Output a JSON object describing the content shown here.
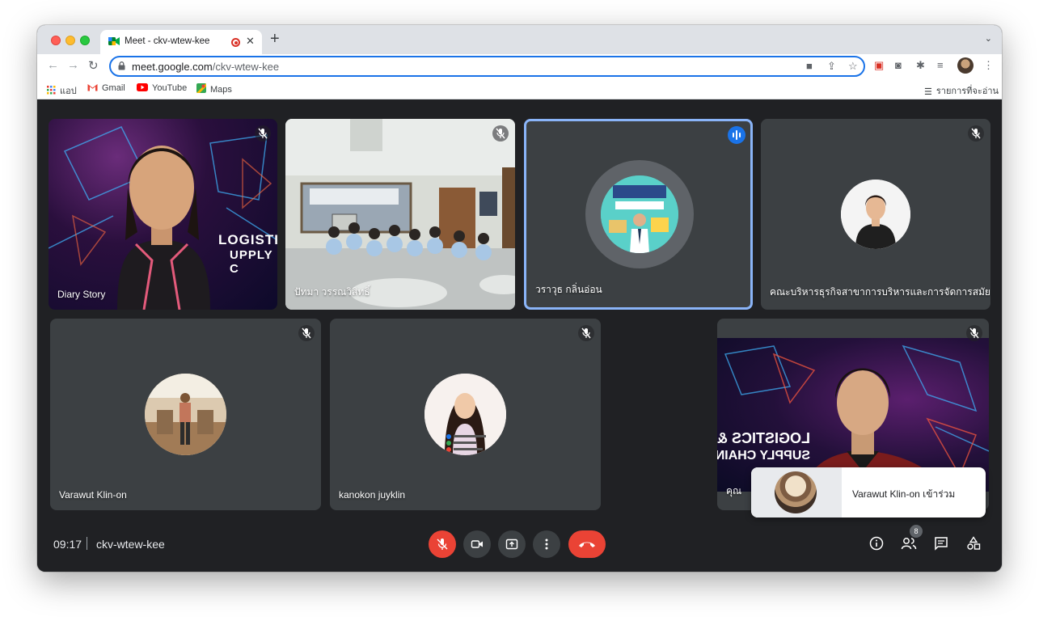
{
  "browser": {
    "tab_title": "Meet - ckv-wtew-kee",
    "new_tab_label": "+",
    "url_host": "meet.google.com",
    "url_path": "/ckv-wtew-kee",
    "bookmarks": [
      {
        "label": "แอป",
        "icon": "apps-grid-icon"
      },
      {
        "label": "Gmail",
        "icon": "gmail-icon"
      },
      {
        "label": "YouTube",
        "icon": "youtube-icon"
      },
      {
        "label": "Maps",
        "icon": "maps-icon"
      }
    ],
    "reading_list": "รายการที่จะอ่าน"
  },
  "participants": [
    {
      "name": "Diary Story",
      "muted": true,
      "video": true
    },
    {
      "name": "ปัทมา วรรณวิสิทธิ์",
      "muted": true,
      "video": true
    },
    {
      "name": "วราวุธ กลิ่นอ่อน",
      "muted": false,
      "speaking": true,
      "video": false
    },
    {
      "name": "คณะบริหารธุรกิจสาขาการบริหารและการจัดการสมัย...",
      "muted": true,
      "video": false
    },
    {
      "name": "Varawut Klin-on",
      "muted": true,
      "video": false
    },
    {
      "name": "kanokon juyklin",
      "muted": true,
      "video": false
    },
    {
      "name": "คุณ",
      "muted": true,
      "video": true
    }
  ],
  "background_text": {
    "logistics_line1": "LOGISTI",
    "logistics_line2": "UPPLY C"
  },
  "toast": {
    "text": "Varawut Klin-on เข้าร่วม"
  },
  "bottom_bar": {
    "time": "09:17",
    "meeting_code": "ckv-wtew-kee",
    "people_count": "8"
  },
  "colors": {
    "meet_bg": "#202124",
    "tile_bg": "#3c4043",
    "accent_blue": "#1a73e8",
    "hangup_red": "#ea4335"
  }
}
